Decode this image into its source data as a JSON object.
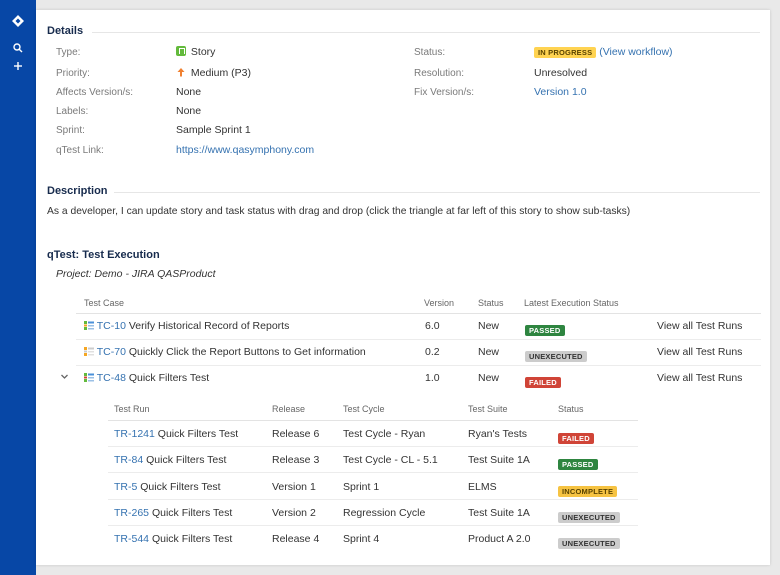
{
  "sidebar": {
    "icons": [
      "jira-logo-icon",
      "search-icon",
      "plus-icon"
    ]
  },
  "details": {
    "title": "Details",
    "type_label": "Type:",
    "type_value": "Story",
    "priority_label": "Priority:",
    "priority_value": "Medium (P3)",
    "affects_label": "Affects Version/s:",
    "affects_value": "None",
    "labels_label": "Labels:",
    "labels_value": "None",
    "sprint_label": "Sprint:",
    "sprint_value": "Sample Sprint 1",
    "qtest_label": "qTest Link:",
    "qtest_value": "https://www.qasymphony.com",
    "status_label": "Status:",
    "status_value": "IN PROGRESS",
    "workflow_link": "(View workflow)",
    "resolution_label": "Resolution:",
    "resolution_value": "Unresolved",
    "fix_label": "Fix Version/s:",
    "fix_value": "Version 1.0"
  },
  "description": {
    "title": "Description",
    "text": "As a developer, I can update story and task status with drag and drop (click the triangle at far left of this story to show sub-tasks)"
  },
  "qtest": {
    "title": "qTest: Test Execution",
    "project": "Project: Demo - JIRA QASProduct",
    "headers": {
      "test_case": "Test Case",
      "version": "Version",
      "status": "Status",
      "latest": "Latest Execution Status"
    },
    "cases": [
      {
        "key": "TC-10",
        "name": "Verify Historical Record of Reports",
        "version": "6.0",
        "status": "New",
        "latest": "PASSED",
        "link": "View all Test Runs"
      },
      {
        "key": "TC-70",
        "name": "Quickly Click the Report Buttons to Get information",
        "version": "0.2",
        "status": "New",
        "latest": "UNEXECUTED",
        "link": "View all Test Runs"
      },
      {
        "key": "TC-48",
        "name": "Quick Filters Test",
        "version": "1.0",
        "status": "New",
        "latest": "FAILED",
        "link": "View all Test Runs"
      }
    ],
    "run_headers": {
      "run": "Test Run",
      "release": "Release",
      "cycle": "Test Cycle",
      "suite": "Test Suite",
      "status": "Status"
    },
    "runs": [
      {
        "key": "TR-1241",
        "name": "Quick Filters Test",
        "release": "Release 6",
        "cycle": "Test Cycle - Ryan",
        "suite": "Ryan's Tests",
        "status": "FAILED"
      },
      {
        "key": "TR-84",
        "name": "Quick Filters Test",
        "release": "Release 3",
        "cycle": "Test Cycle - CL - 5.1",
        "suite": "Test Suite 1A",
        "status": "PASSED"
      },
      {
        "key": "TR-5",
        "name": "Quick Filters Test",
        "release": "Version 1",
        "cycle": "Sprint 1",
        "suite": "ELMS",
        "status": "INCOMPLETE"
      },
      {
        "key": "TR-265",
        "name": "Quick Filters Test",
        "release": "Version 2",
        "cycle": "Regression Cycle",
        "suite": "Test Suite 1A",
        "status": "UNEXECUTED"
      },
      {
        "key": "TR-544",
        "name": "Quick Filters Test",
        "release": "Release 4",
        "cycle": "Sprint 4",
        "suite": "Product A 2.0",
        "status": "UNEXECUTED"
      }
    ]
  }
}
